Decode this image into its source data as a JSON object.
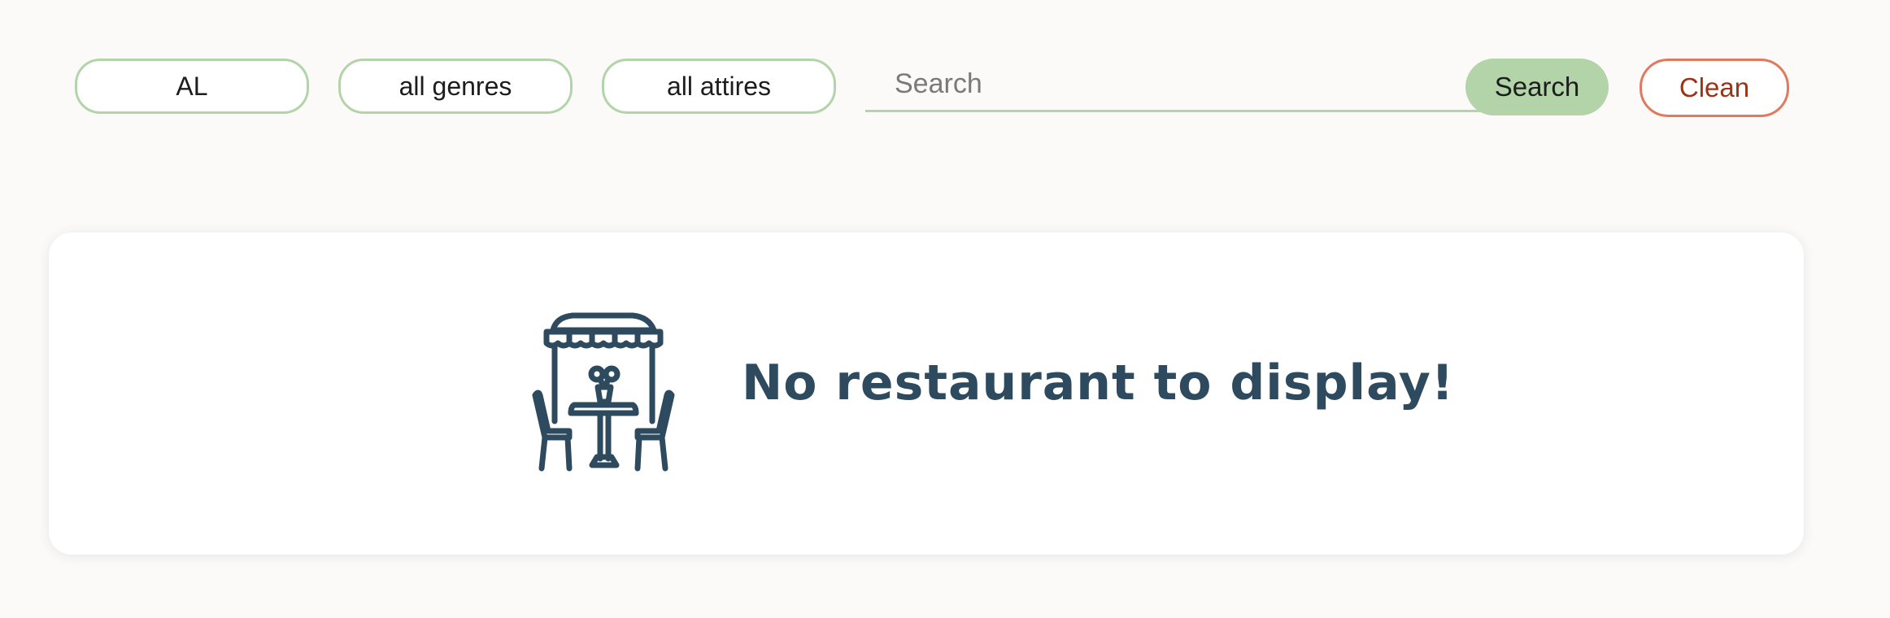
{
  "filters": {
    "state_value": "AL",
    "genre_value": "all genres",
    "attire_value": "all attires"
  },
  "search": {
    "placeholder": "Search",
    "value": "",
    "button_label": "Search"
  },
  "clean": {
    "label": "Clean"
  },
  "results": {
    "empty_message": "No restaurant to display!",
    "empty_icon": "outdoor-cafe-table-icon"
  },
  "colors": {
    "background": "#fbfaf8",
    "accent_green": "#b2d4a8",
    "clean_border": "#df7a5f",
    "clean_text": "#9a3416",
    "icon_and_message": "#2d4a5e"
  }
}
